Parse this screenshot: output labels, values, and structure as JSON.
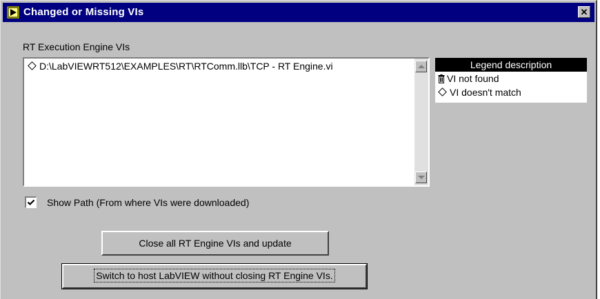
{
  "window": {
    "title": "Changed or Missing VIs",
    "close_label": "✕"
  },
  "section": {
    "label": "RT Execution Engine VIs"
  },
  "list": {
    "items": [
      {
        "icon": "diamond-icon",
        "text": "D:\\LabVIEWRT512\\EXAMPLES\\RT\\RTComm.llb\\TCP - RT Engine.vi"
      }
    ]
  },
  "legend": {
    "header": "Legend description",
    "rows": [
      {
        "icon": "trash-icon",
        "text": "VI not found"
      },
      {
        "icon": "diamond-icon",
        "text": "VI doesn't match"
      }
    ]
  },
  "show_path": {
    "checked": true,
    "label": "Show Path (From where VIs were downloaded)"
  },
  "buttons": {
    "close_all": "Close all RT Engine VIs and update",
    "switch_host": "Switch to host LabVIEW without closing RT Engine VIs."
  },
  "colors": {
    "titlebar": "#000080",
    "face": "#c0c0c0",
    "legend_header": "#000000"
  }
}
